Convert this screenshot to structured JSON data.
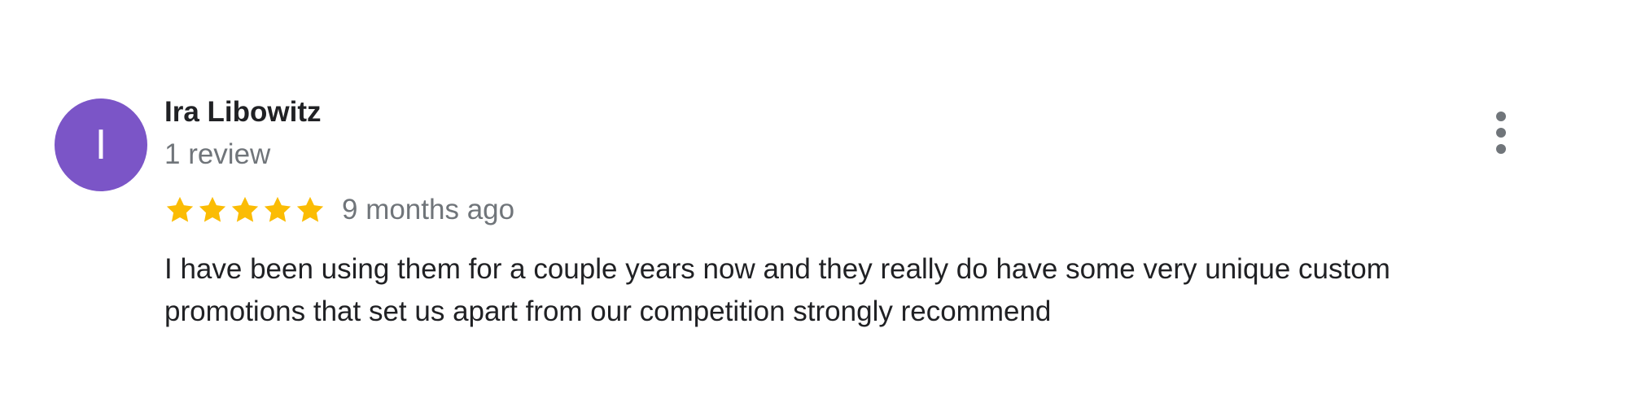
{
  "reviewer": {
    "initial": "I",
    "name": "Ira Libowitz",
    "review_count": "1 review",
    "avatar_color": "#7b55c7"
  },
  "review": {
    "rating": 5,
    "max_rating": 5,
    "star_color": "#fbbc04",
    "date": "9 months ago",
    "text": "I have been using them for a couple years now and they really do have some very unique custom promotions that set us apart from our competition strongly recommend"
  },
  "menu": {
    "icon": "more-vert-icon"
  }
}
